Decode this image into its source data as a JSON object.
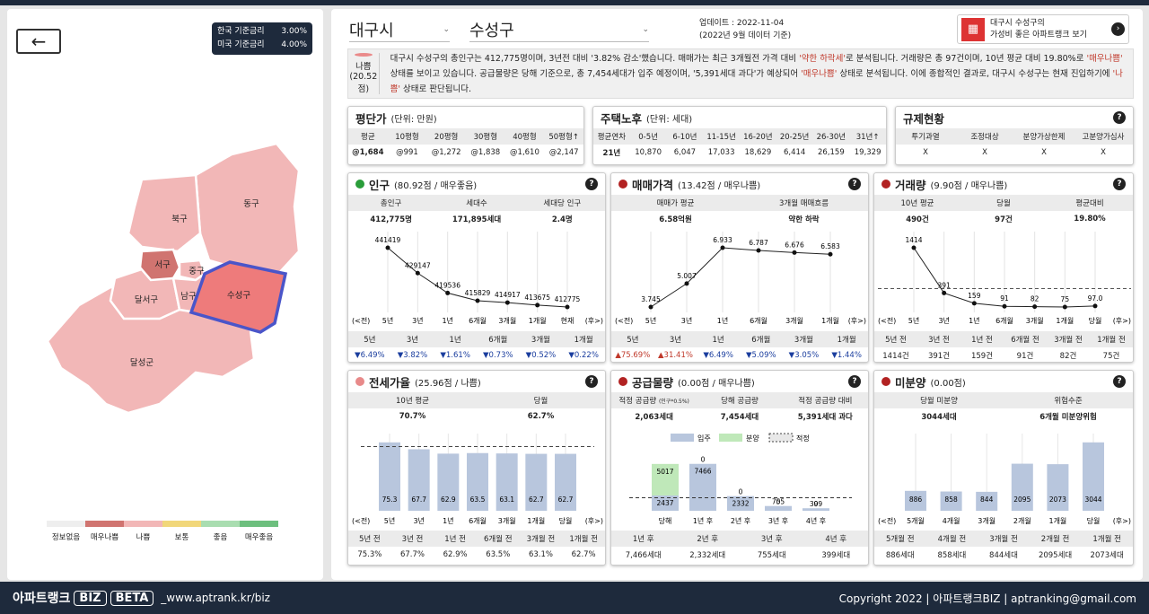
{
  "footer": {
    "brand": "아파트랭크",
    "tag1": "BIZ",
    "tag2": "BETA",
    "url": "_www.aptrank.kr/biz",
    "copyright": "Copyright 2022 | 아파트랭크BIZ | aptranking@gmail.com"
  },
  "rates": [
    {
      "label": "한국 기준금리",
      "value": "3.00%"
    },
    {
      "label": "미국 기준금리",
      "value": "4.00%"
    }
  ],
  "map": {
    "districts": [
      "북구",
      "동구",
      "서구",
      "중구",
      "남구",
      "수성구",
      "달서구",
      "달성군"
    ],
    "selected": "수성구"
  },
  "legend": [
    {
      "label": "정보없음",
      "color": "#eeeeee"
    },
    {
      "label": "매우나쁨",
      "color": "#d07470"
    },
    {
      "label": "나쁨",
      "color": "#f2b7b7"
    },
    {
      "label": "보통",
      "color": "#f1d77a"
    },
    {
      "label": "좋음",
      "color": "#a9ddb0"
    },
    {
      "label": "매우좋음",
      "color": "#6dbf7e"
    }
  ],
  "header": {
    "city": "대구시",
    "district": "수성구",
    "update": "업데이트 : 2022-11-04",
    "basis": "(2022년 9월 데이터 기준)",
    "promo1": "대구시 수성구의",
    "promo2": "가성비 좋은 아파트랭크 보기"
  },
  "summary": {
    "status": "나쁨",
    "score": "(20.52점)",
    "t1": "대구시 수성구의 총인구는 412,775명이며, 3년전 대비 '3.82% 감소'했습니다. 매매가는 최근 3개월전 가격 대비 ",
    "h1": "'약한 하락세'",
    "t2": "로 분석됩니다. 거래량은 총 97건이며, 10년 평균 대비 19.80%로 ",
    "h2": "'매우나쁨'",
    "t3": " 상태를 보이고 있습니다. 공급물량은 당해 기준으로, 총 7,454세대가 입주 예정이며, '5,391세대 과다'가 예상되어 ",
    "h3": "'매우나쁨'",
    "t4": " 상태로 분석됩니다. 이에 종합적인 결과로, 대구시 수성구는 현재 진입하기에 ",
    "h4": "'나쁨'",
    "t5": " 상태로 판단됩니다."
  },
  "price_per_pyeong": {
    "title": "평단가",
    "unit": "(단위: 만원)",
    "headers": [
      "평균",
      "10평형",
      "20평형",
      "30평형",
      "40평형",
      "50평형↑"
    ],
    "values": [
      "@1,684",
      "@991",
      "@1,272",
      "@1,838",
      "@1,610",
      "@2,147"
    ]
  },
  "housing_age": {
    "title": "주택노후",
    "unit": "(단위: 세대)",
    "headers": [
      "평균연차",
      "0-5년",
      "6-10년",
      "11-15년",
      "16-20년",
      "20-25년",
      "26-30년",
      "31년↑"
    ],
    "values": [
      "21년",
      "10,870",
      "6,047",
      "17,033",
      "18,629",
      "6,414",
      "26,159",
      "19,329"
    ]
  },
  "regulation": {
    "title": "규제현황",
    "headers": [
      "투기과열",
      "조정대상",
      "분양가상한제",
      "고분양가심사"
    ],
    "values": [
      "X",
      "X",
      "X",
      "X"
    ]
  },
  "population": {
    "title": "인구",
    "score": "(80.92점 / 매우좋음)",
    "color": "#2a9d3a",
    "headers": [
      "총인구",
      "세대수",
      "세대당 인구"
    ],
    "values": [
      "412,775명",
      "171,895세대",
      "2.4명"
    ],
    "chart_data": {
      "type": "line",
      "x": [
        "5년",
        "3년",
        "1년",
        "6개월",
        "3개월",
        "1개월",
        "현재"
      ],
      "values": [
        441419,
        429147,
        419536,
        415829,
        414917,
        413675,
        412775
      ],
      "labels": [
        "441419",
        "429147",
        "419536",
        "415829",
        "414917",
        "413675",
        "412775"
      ]
    },
    "left_label": "(<전)",
    "right_label": "(후>)",
    "change_headers": [
      "5년",
      "3년",
      "1년",
      "6개월",
      "3개월",
      "1개월"
    ],
    "changes": [
      "▼6.49%",
      "▼3.82%",
      "▼1.61%",
      "▼0.73%",
      "▼0.52%",
      "▼0.22%"
    ]
  },
  "sale_price": {
    "title": "매매가격",
    "score": "(13.42점 / 매우나쁨)",
    "color": "#b22222",
    "headers": [
      "매매가 평균",
      "3개월 매매흐름"
    ],
    "values": [
      "6.58억원",
      "약한 하락"
    ],
    "chart_data": {
      "type": "line",
      "x": [
        "5년",
        "3년",
        "1년",
        "6개월",
        "3개월",
        "1개월"
      ],
      "values": [
        3.745,
        5.007,
        6.933,
        6.787,
        6.676,
        6.583
      ],
      "labels": [
        "3.745",
        "5.007",
        "6.933",
        "6.787",
        "6.676",
        "6.583"
      ]
    },
    "left_label": "(<전)",
    "right_label": "(후>)",
    "change_headers": [
      "5년",
      "3년",
      "1년",
      "6개월",
      "3개월",
      "1개월"
    ],
    "changes": [
      "▲75.69%",
      "▲31.41%",
      "▼6.49%",
      "▼5.09%",
      "▼3.05%",
      "▼1.44%"
    ]
  },
  "volume": {
    "title": "거래량",
    "score": "(9.90점 / 매우나쁨)",
    "color": "#b22222",
    "headers": [
      "10년 평균",
      "당월",
      "평균대비"
    ],
    "values": [
      "490건",
      "97건",
      "19.80%"
    ],
    "chart_data": {
      "type": "line",
      "x": [
        "5년",
        "3년",
        "1년",
        "6개월",
        "3개월",
        "1개월",
        "당월"
      ],
      "values": [
        1414,
        391,
        159,
        91,
        82,
        75,
        97
      ],
      "labels": [
        "1414",
        "391",
        "159",
        "91",
        "82",
        "75",
        "97.0"
      ],
      "reference": 490
    },
    "left_label": "(<전)",
    "right_label": "(후>)",
    "change_headers": [
      "5년 전",
      "3년 전",
      "1년 전",
      "6개월 전",
      "3개월 전",
      "1개월 전"
    ],
    "changes": [
      "1414건",
      "391건",
      "159건",
      "91건",
      "82건",
      "75건"
    ]
  },
  "jeonse": {
    "title": "전세가율",
    "score": "(25.96점 / 나쁨)",
    "color": "#e88a8a",
    "headers": [
      "10년 평균",
      "당월"
    ],
    "values": [
      "70.7%",
      "62.7%"
    ],
    "chart_data": {
      "type": "bar",
      "categories": [
        "5년",
        "3년",
        "1년",
        "6개월",
        "3개월",
        "1개월",
        "당월"
      ],
      "values": [
        75.3,
        67.7,
        62.9,
        63.5,
        63.1,
        62.7,
        62.7
      ],
      "labels": [
        "75.3",
        "67.7",
        "62.9",
        "63.5",
        "63.1",
        "62.7",
        "62.7"
      ],
      "reference": 70.7
    },
    "left_label": "(<전)",
    "right_label": "(후>)",
    "change_headers": [
      "5년 전",
      "3년 전",
      "1년 전",
      "6개월 전",
      "3개월 전",
      "1개월 전"
    ],
    "changes": [
      "75.3%",
      "67.7%",
      "62.9%",
      "63.5%",
      "63.1%",
      "62.7%"
    ]
  },
  "supply": {
    "title": "공급물량",
    "score": "(0.00점 / 매우나쁨)",
    "color": "#b22222",
    "headers": [
      "적정 공급량",
      "당해 공급량",
      "적정 공급량 대비"
    ],
    "header_sub": "(인구*0.5%)",
    "values": [
      "2,063세대",
      "7,454세대",
      "5,391세대 과다"
    ],
    "legend": [
      "입주",
      "분양",
      "적정"
    ],
    "chart_data": {
      "type": "bar",
      "categories": [
        "당해",
        "1년 후",
        "2년 후",
        "3년 후",
        "4년 후"
      ],
      "series": [
        {
          "name": "입주",
          "values": [
            2437,
            7466,
            2332,
            755,
            399
          ]
        },
        {
          "name": "분양",
          "values": [
            5017,
            0,
            0,
            0,
            0
          ]
        }
      ],
      "reference": 2063,
      "labels_a": [
        "2437",
        "7466",
        "2332",
        "755",
        "399"
      ],
      "labels_b": [
        "5017",
        "0",
        "0",
        "0",
        "0"
      ]
    },
    "change_headers": [
      "1년 후",
      "2년 후",
      "3년 후",
      "4년 후"
    ],
    "changes": [
      "7,466세대",
      "2,332세대",
      "755세대",
      "399세대"
    ]
  },
  "unsold": {
    "title": "미분양",
    "score": "(0.00점)",
    "color": "#b22222",
    "headers": [
      "당월 미분양",
      "위험수준"
    ],
    "values": [
      "3044세대",
      "6개월 미분양위험"
    ],
    "chart_data": {
      "type": "bar",
      "categories": [
        "5개월",
        "4개월",
        "3개월",
        "2개월",
        "1개월",
        "당월"
      ],
      "values": [
        886,
        858,
        844,
        2095,
        2073,
        3044
      ],
      "labels": [
        "886",
        "858",
        "844",
        "2095",
        "2073",
        "3044"
      ]
    },
    "left_label": "(<전)",
    "right_label": "(후>)",
    "change_headers": [
      "5개월 전",
      "4개월 전",
      "3개월 전",
      "2개월 전",
      "1개월 전"
    ],
    "changes": [
      "886세대",
      "858세대",
      "844세대",
      "2095세대",
      "2073세대"
    ]
  }
}
